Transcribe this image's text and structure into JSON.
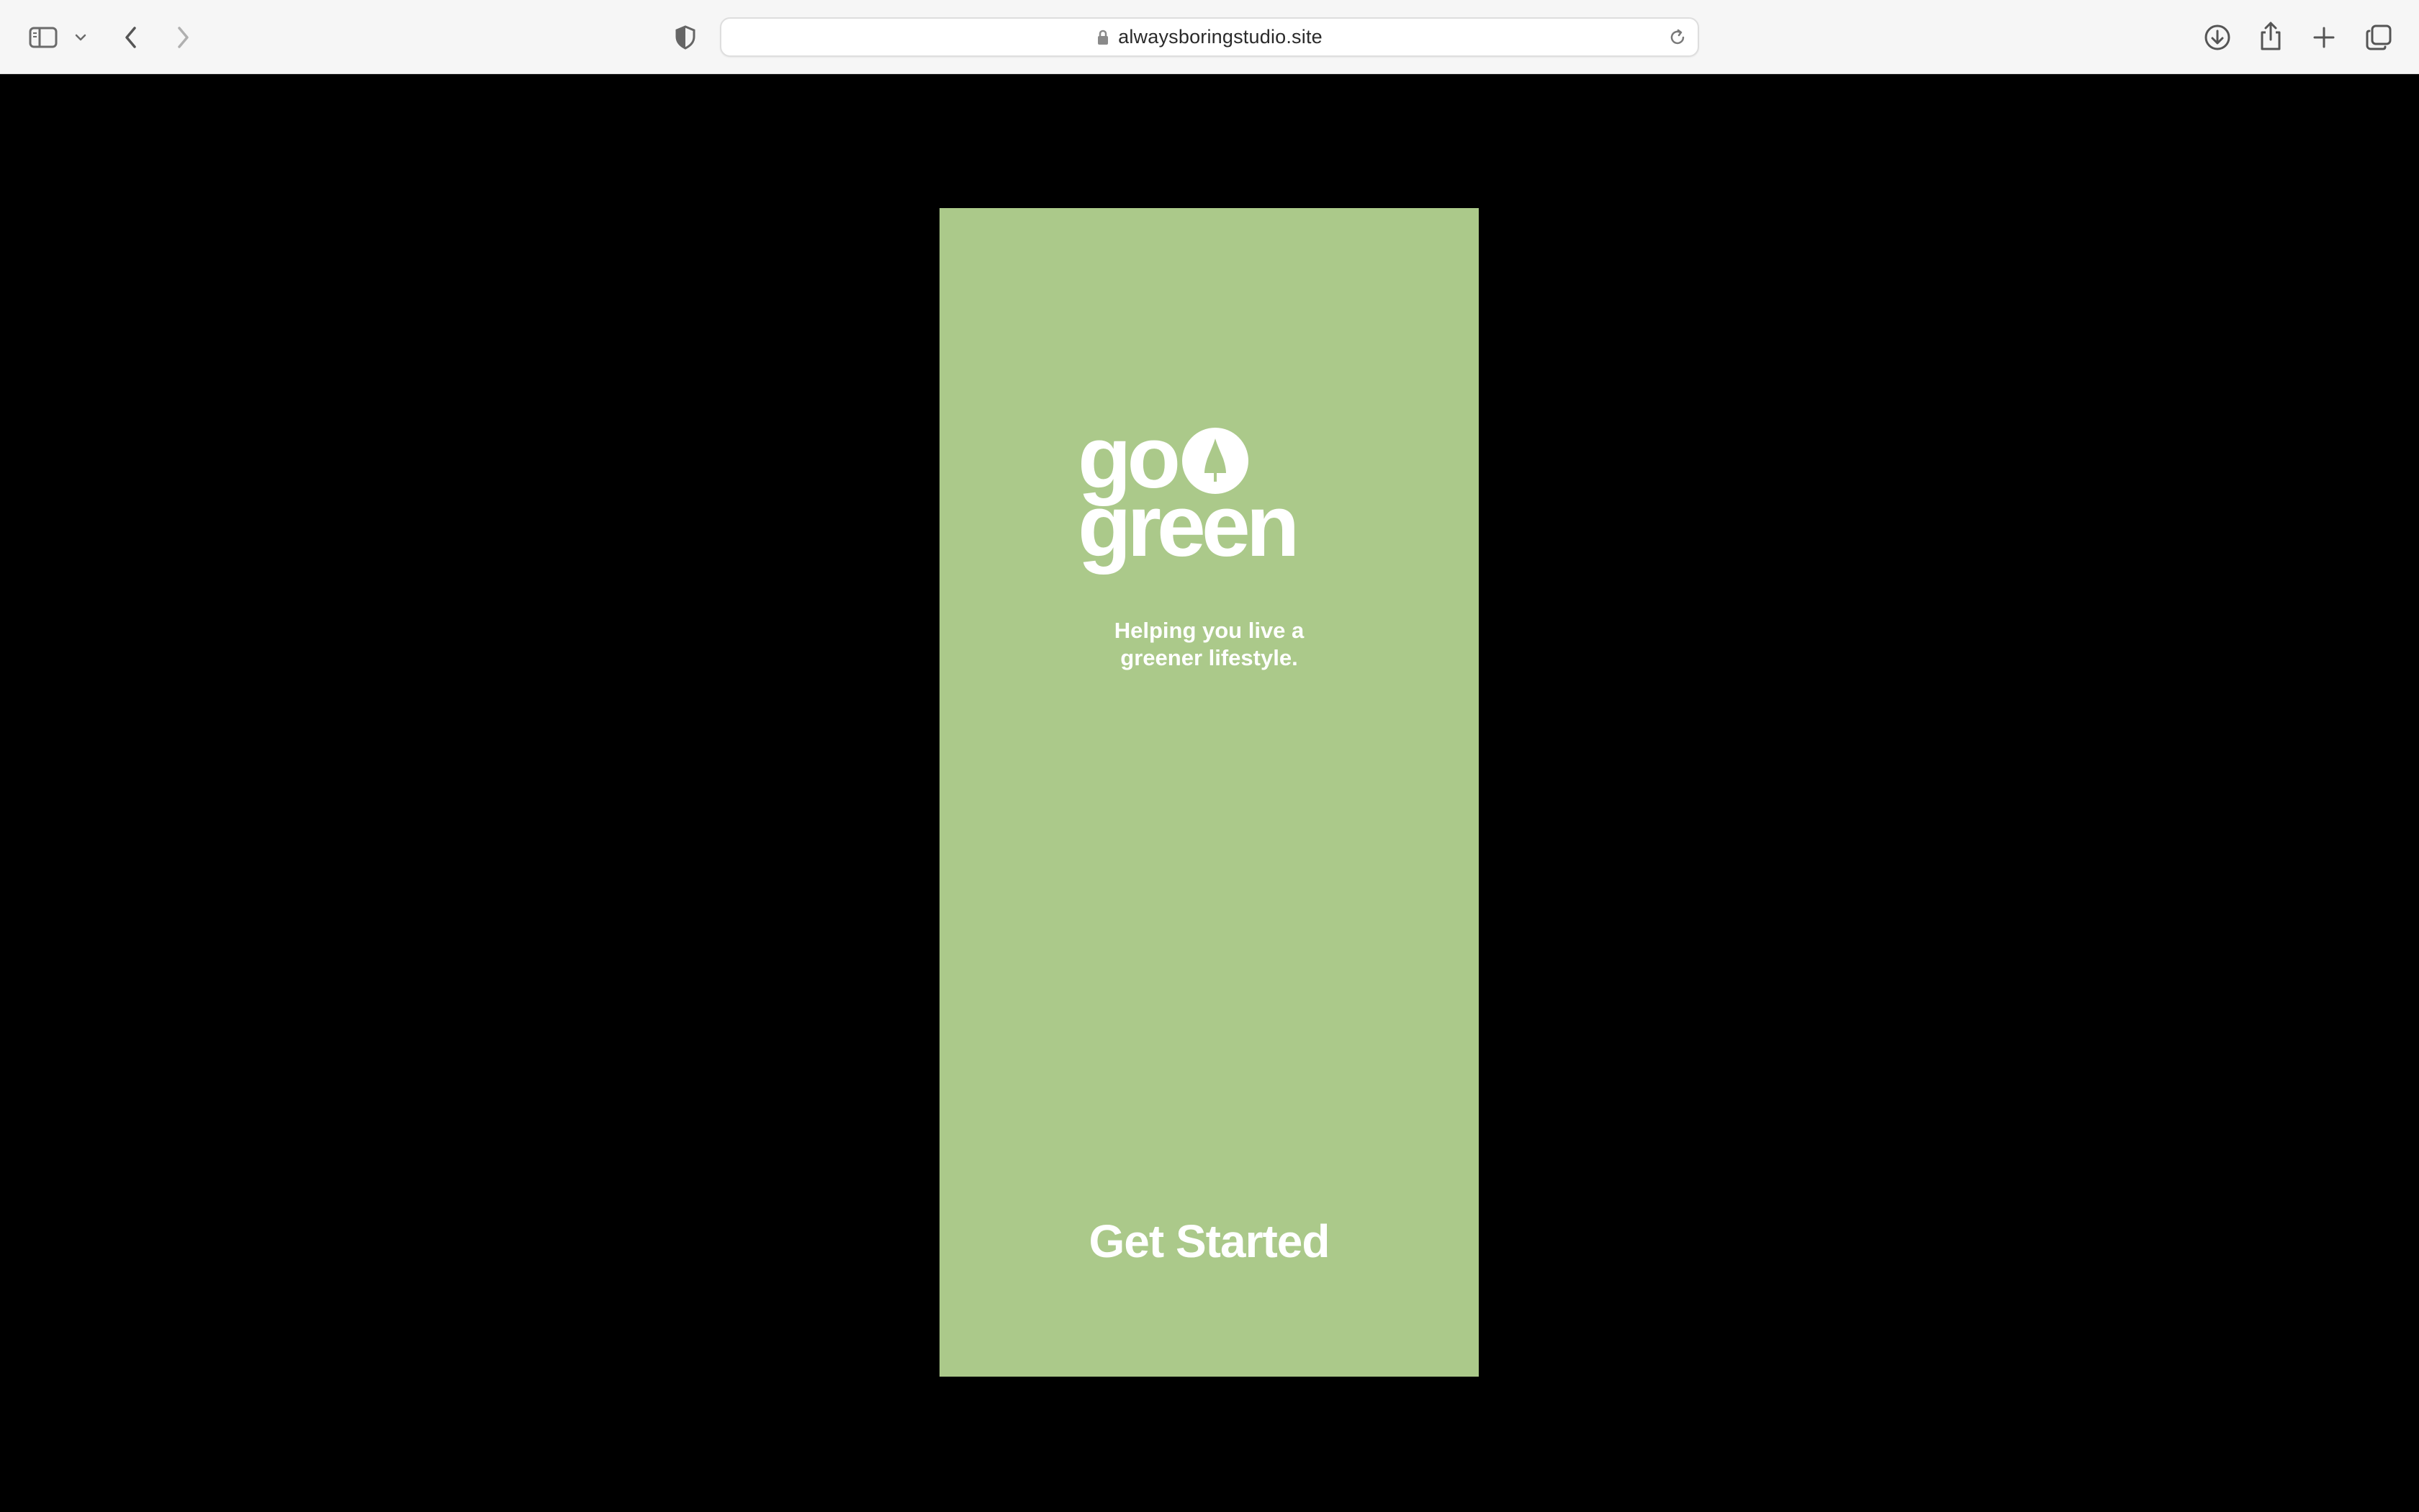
{
  "browser": {
    "url": "alwaysboringstudio.site",
    "icons": {
      "sidebar": "sidebar-icon",
      "sidebar_menu": "chevron-down-icon",
      "back": "chevron-left-icon",
      "forward": "chevron-right-icon",
      "privacy": "shield-icon",
      "lock": "lock-icon",
      "reload": "reload-icon",
      "downloads": "download-icon",
      "share": "share-icon",
      "new_tab": "plus-icon",
      "tabs": "tab-overview-icon"
    }
  },
  "page": {
    "logo": {
      "line1": "go",
      "line2": "green"
    },
    "tagline": {
      "line1": "Helping you live a",
      "line2": "greener lifestyle."
    },
    "cta_label": "Get Started",
    "colors": {
      "background": "#000000",
      "card": "#abc98a",
      "text": "#ffffff"
    }
  }
}
